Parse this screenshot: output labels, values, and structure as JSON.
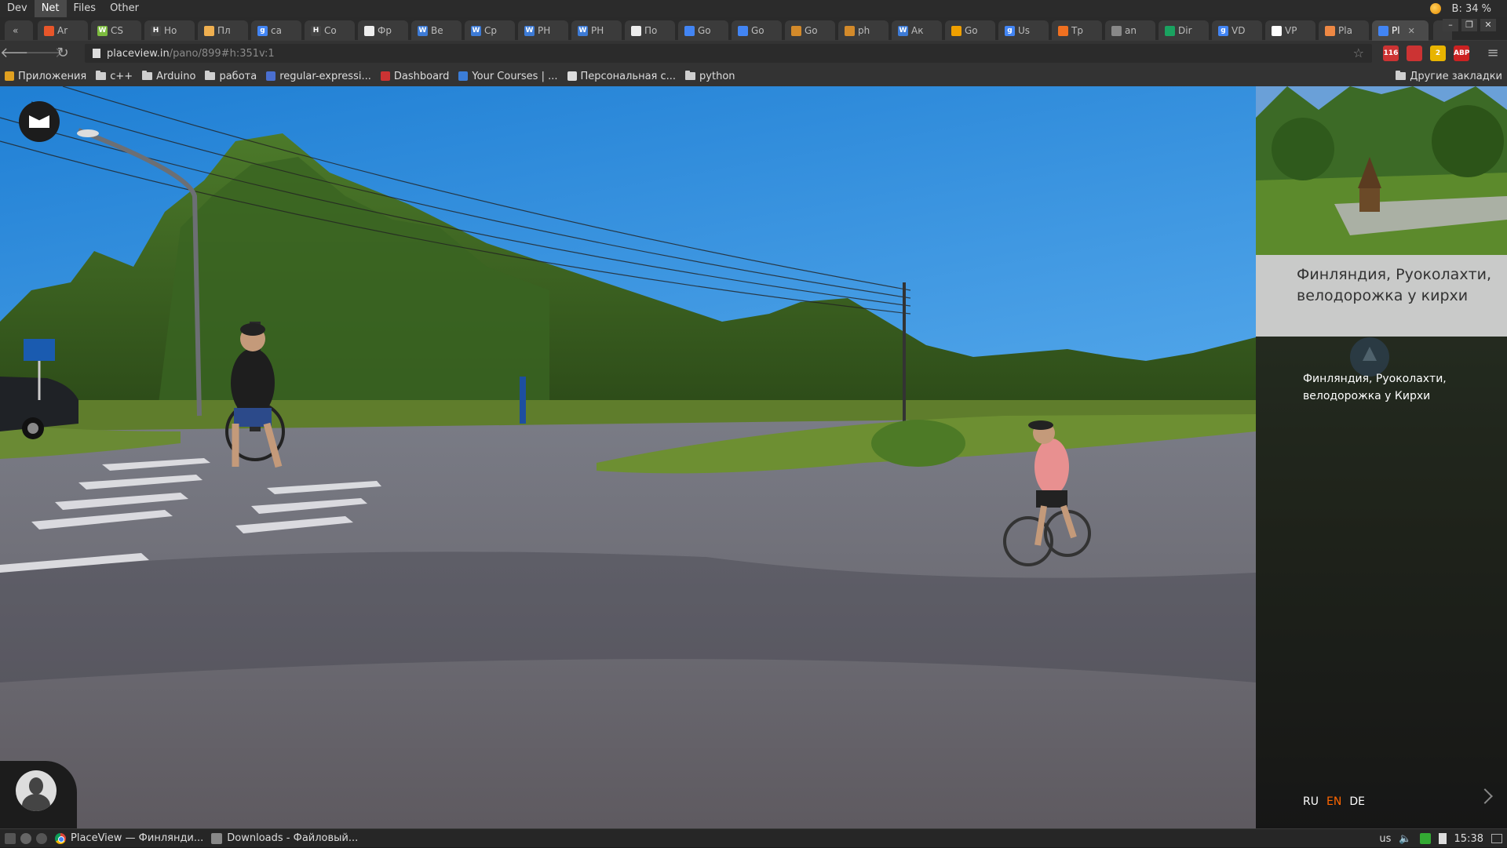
{
  "menubar": {
    "items": [
      "Dev",
      "Net",
      "Files",
      "Other"
    ],
    "active": "Net",
    "battery": "B:  34 %"
  },
  "tabs": [
    {
      "label": "Ar",
      "color": "#e8562a",
      "glyph": ""
    },
    {
      "label": "CS",
      "color": "#7cbb3e",
      "glyph": "W"
    },
    {
      "label": "Ho",
      "color": "#444",
      "glyph": "H"
    },
    {
      "label": "Пл",
      "color": "#f0b050",
      "glyph": ""
    },
    {
      "label": "ca",
      "color": "#4285f4",
      "glyph": "g"
    },
    {
      "label": "Co",
      "color": "#444",
      "glyph": "H"
    },
    {
      "label": "Фр",
      "color": "#eee",
      "glyph": ""
    },
    {
      "label": "Be",
      "color": "#3d7bd6",
      "glyph": "W"
    },
    {
      "label": "Ср",
      "color": "#3d7bd6",
      "glyph": "W"
    },
    {
      "label": "PH",
      "color": "#3d7bd6",
      "glyph": "W"
    },
    {
      "label": "PH",
      "color": "#3d7bd6",
      "glyph": "W"
    },
    {
      "label": "По",
      "color": "#eee",
      "glyph": ""
    },
    {
      "label": "Go",
      "color": "#4285f4",
      "glyph": ""
    },
    {
      "label": "Go",
      "color": "#4285f4",
      "glyph": ""
    },
    {
      "label": "Go",
      "color": "#d38a2a",
      "glyph": ""
    },
    {
      "label": "ph",
      "color": "#d38a2a",
      "glyph": ""
    },
    {
      "label": "Ак",
      "color": "#3d7bd6",
      "glyph": "W"
    },
    {
      "label": "Go",
      "color": "#f0a000",
      "glyph": ""
    },
    {
      "label": "Us",
      "color": "#4285f4",
      "glyph": "g"
    },
    {
      "label": "Тр",
      "color": "#f07020",
      "glyph": ""
    },
    {
      "label": "an",
      "color": "#888",
      "glyph": ""
    },
    {
      "label": "Dir",
      "color": "#1aa260",
      "glyph": ""
    },
    {
      "label": "VD",
      "color": "#4285f4",
      "glyph": "g"
    },
    {
      "label": "VP",
      "color": "#fff",
      "glyph": "W"
    },
    {
      "label": "Pla",
      "color": "#e84",
      "glyph": ""
    },
    {
      "label": "Pl",
      "color": "#4285f4",
      "glyph": "",
      "active": true
    }
  ],
  "address": {
    "host": "placeview.in",
    "path": "/pano/899#h:351v:1"
  },
  "extensions": [
    {
      "name": "gmail-extension-icon",
      "label": "116",
      "color": "#c33"
    },
    {
      "name": "bookmark-extension-icon",
      "label": "",
      "color": "#c33"
    },
    {
      "name": "notes-extension-icon",
      "label": "2",
      "color": "#e8b400"
    },
    {
      "name": "adblock-extension-icon",
      "label": "ABP",
      "color": "#c22"
    }
  ],
  "bookmarks": {
    "items": [
      {
        "label": "Приложения",
        "icon": "apps-icon"
      },
      {
        "label": "c++",
        "icon": "folder-icon"
      },
      {
        "label": "Arduino",
        "icon": "folder-icon"
      },
      {
        "label": "работа",
        "icon": "folder-icon"
      },
      {
        "label": "regular-expressi...",
        "icon": "page-icon"
      },
      {
        "label": "Dashboard",
        "icon": "dashboard-icon"
      },
      {
        "label": "Your Courses | ...",
        "icon": "courses-icon"
      },
      {
        "label": "Персональная с...",
        "icon": "play-icon"
      },
      {
        "label": "python",
        "icon": "folder-icon"
      }
    ],
    "other": "Другие закладки"
  },
  "sidebar": {
    "title": "Финляндия, Руоколахти, велодорожка у кирхи",
    "caption": "Финляндия, Руоколахти, велодорожка у Кирхи",
    "languages": [
      "RU",
      "EN",
      "DE"
    ],
    "selected_language": "EN"
  },
  "taskbar": {
    "tasks": [
      {
        "label": "PlaceView — Финлянди...",
        "icon": "chrome-icon"
      },
      {
        "label": "Downloads - Файловый...",
        "icon": "file-manager-icon"
      }
    ],
    "layout": "us",
    "clock": "15:38"
  }
}
